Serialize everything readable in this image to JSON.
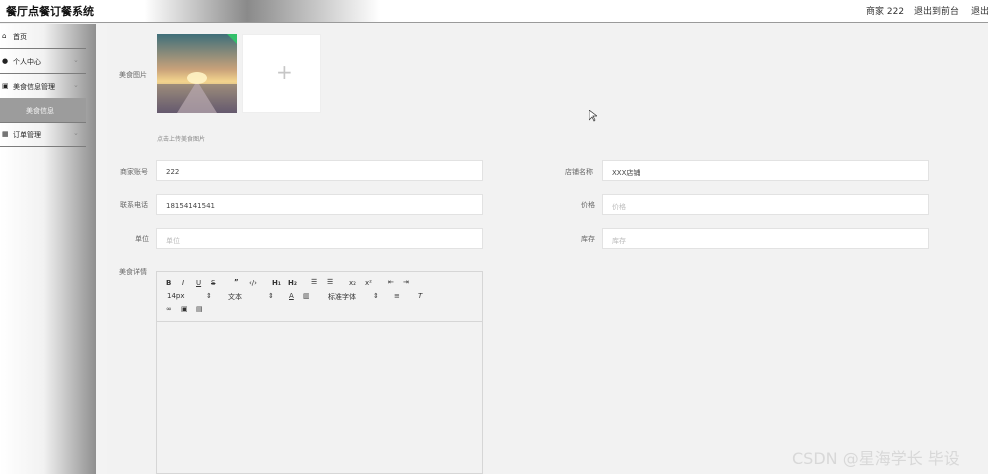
{
  "header": {
    "app_title": "餐厅点餐订餐系统",
    "user_label": "商家 222",
    "exit_front_label": "退出到前台",
    "logout_label": "退出"
  },
  "sidebar": {
    "items": [
      {
        "label": "首页",
        "icon": "home-icon"
      },
      {
        "label": "个人中心",
        "icon": "user-icon"
      },
      {
        "label": "美食信息管理",
        "icon": "grid-icon"
      },
      {
        "label": "美食信息",
        "icon": ""
      },
      {
        "label": "订单管理",
        "icon": "grid-icon"
      }
    ]
  },
  "form": {
    "image_label": "美食图片",
    "upload_hint": "点击上传美食图片",
    "merchant_account_label": "商家账号",
    "merchant_account_value": "222",
    "shop_name_label": "店铺名称",
    "shop_name_value": "XXX店铺",
    "phone_label": "联系电话",
    "phone_value": "18154141541",
    "price_label": "价格",
    "price_placeholder": "价格",
    "unit_label": "单位",
    "unit_placeholder": "单位",
    "stock_label": "库存",
    "stock_placeholder": "库存",
    "detail_label": "美食详情"
  },
  "editor": {
    "font_size": "14px",
    "text_type": "文本",
    "font_family": "标准字体",
    "h1": "H₁",
    "h2": "H₂",
    "sub": "x₂",
    "sup": "x²"
  },
  "watermark": "CSDN @星海学长 毕设"
}
